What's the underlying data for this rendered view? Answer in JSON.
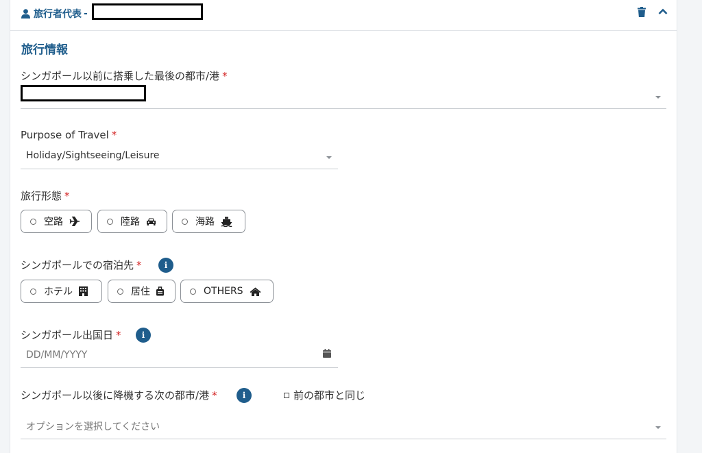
{
  "header": {
    "traveller_label": "旅行者代表",
    "separator": "-"
  },
  "section_title": "旅行情報",
  "required_mark": "*",
  "last_city": {
    "label": "シンガポール以前に搭乗した最後の都市/港"
  },
  "purpose": {
    "label": "Purpose of Travel",
    "value": "Holiday/Sightseeing/Leisure"
  },
  "travel_mode": {
    "label": "旅行形態",
    "options": [
      {
        "label": "空路",
        "icon": "plane-icon"
      },
      {
        "label": "陸路",
        "icon": "car-icon"
      },
      {
        "label": "海路",
        "icon": "ship-icon"
      }
    ]
  },
  "accommodation": {
    "label": "シンガポールでの宿泊先",
    "options": [
      {
        "label": "ホテル",
        "icon": "building-icon"
      },
      {
        "label": "居住",
        "icon": "luggage-icon"
      },
      {
        "label": "OTHERS",
        "icon": "home-icon"
      }
    ]
  },
  "departure_date": {
    "label": "シンガポール出国日",
    "placeholder": "DD/MM/YYYY"
  },
  "next_city": {
    "label": "シンガポール以後に降機する次の都市/港",
    "same_as_previous": "前の都市と同じ",
    "placeholder": "オプションを選択してください"
  },
  "colors": {
    "accent": "#1f5d8c",
    "required": "#d21f1f"
  }
}
